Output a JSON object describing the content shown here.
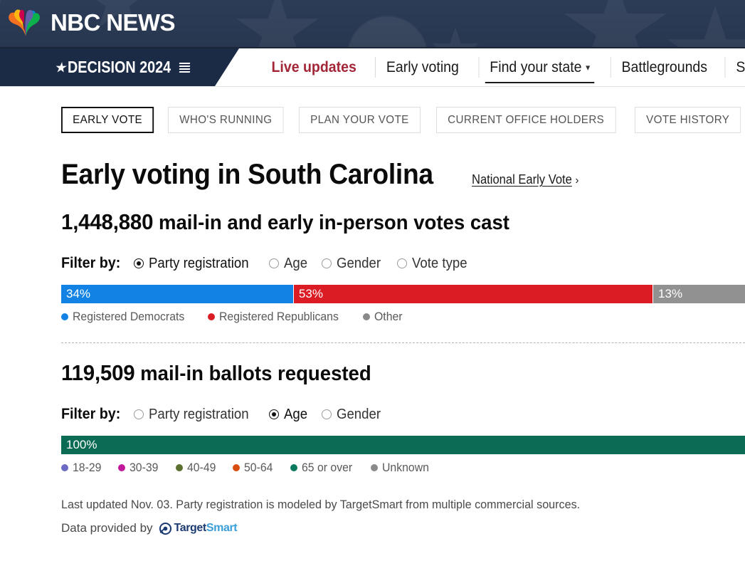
{
  "masthead": {
    "brand": "NBC NEWS",
    "logo_icon": "nbc-peacock-icon"
  },
  "nav": {
    "decision_label": "DECISION 2024",
    "links": [
      {
        "label": "Live updates",
        "state": "live"
      },
      {
        "label": "Early voting",
        "state": "default"
      },
      {
        "label": "Find your state",
        "state": "active",
        "has_chevron": true,
        "chevron": "⌄"
      },
      {
        "label": "Battlegrounds",
        "state": "default"
      },
      {
        "label": "Senate",
        "state": "default"
      }
    ]
  },
  "tabs": [
    {
      "label": "EARLY VOTE",
      "active": true
    },
    {
      "label": "WHO'S RUNNING",
      "active": false
    },
    {
      "label": "PLAN YOUR VOTE",
      "active": false
    },
    {
      "label": "CURRENT OFFICE HOLDERS",
      "active": false
    },
    {
      "label": "VOTE HISTORY",
      "active": false
    }
  ],
  "header": {
    "title": "Early voting in South Carolina",
    "link_label": "National Early Vote",
    "link_arrow": "›"
  },
  "section_votes": {
    "count": "1,448,880",
    "description": "mail-in and early in-person votes cast",
    "filter_label": "Filter by:",
    "filter_options": [
      {
        "label": "Party registration",
        "selected": true
      },
      {
        "label": "Age",
        "selected": false
      },
      {
        "label": "Gender",
        "selected": false
      },
      {
        "label": "Vote type",
        "selected": false
      }
    ]
  },
  "section_ballots": {
    "count": "119,509",
    "description": "mail-in ballots requested",
    "filter_label": "Filter by:",
    "filter_options": [
      {
        "label": "Party registration",
        "selected": false
      },
      {
        "label": "Age",
        "selected": true
      },
      {
        "label": "Gender",
        "selected": false
      }
    ]
  },
  "footer": {
    "note": "Last updated Nov. 03. Party registration is modeled by TargetSmart from multiple commercial sources.",
    "provided_by": "Data provided by",
    "provider_name_part1": "Target",
    "provider_name_part2": "Smart",
    "provider_icon": "targetsmart-target-arrow-icon"
  },
  "chart_data": [
    {
      "type": "bar",
      "title": "1,448,880 mail-in and early in-person votes cast",
      "orientation": "horizontal-stacked",
      "unit": "percent",
      "categories": [
        "Registered Democrats",
        "Registered Republicans",
        "Other"
      ],
      "values": [
        34,
        53,
        13
      ],
      "labels": [
        "34%",
        "53%",
        "13%"
      ],
      "colors": [
        "#1283E4",
        "#DC1C24",
        "#919191"
      ],
      "legend_position": "below",
      "grid": false,
      "xlabel": "",
      "ylabel": ""
    },
    {
      "type": "bar",
      "title": "119,509 mail-in ballots requested",
      "orientation": "horizontal-stacked",
      "unit": "percent",
      "categories": [
        "18-29",
        "30-39",
        "40-49",
        "50-64",
        "65 or over",
        "Unknown"
      ],
      "values": [
        0,
        0,
        0,
        0,
        100,
        0
      ],
      "labels": [
        "100%"
      ],
      "visible_segments": [
        {
          "label": "100%",
          "value": 100,
          "color": "#0C6B55"
        }
      ],
      "colors": [
        "#6B6BC4",
        "#C2189A",
        "#5C7030",
        "#D94E10",
        "#0C6B55",
        "#8A8A8A"
      ],
      "legend_position": "below",
      "grid": false,
      "xlabel": "",
      "ylabel": ""
    }
  ],
  "legend_votes": [
    {
      "label": "Registered Democrats",
      "color": "#1283E4"
    },
    {
      "label": "Registered Republicans",
      "color": "#DC1C24"
    },
    {
      "label": "Other",
      "color": "#8A8A8A"
    }
  ],
  "legend_ages": [
    {
      "label": "18-29",
      "color": "#6B6BC4"
    },
    {
      "label": "30-39",
      "color": "#C2189A"
    },
    {
      "label": "40-49",
      "color": "#5C7030"
    },
    {
      "label": "50-64",
      "color": "#D94E10"
    },
    {
      "label": "65 or over",
      "color": "#0A7A5E"
    },
    {
      "label": "Unknown",
      "color": "#8A8A8A"
    }
  ]
}
